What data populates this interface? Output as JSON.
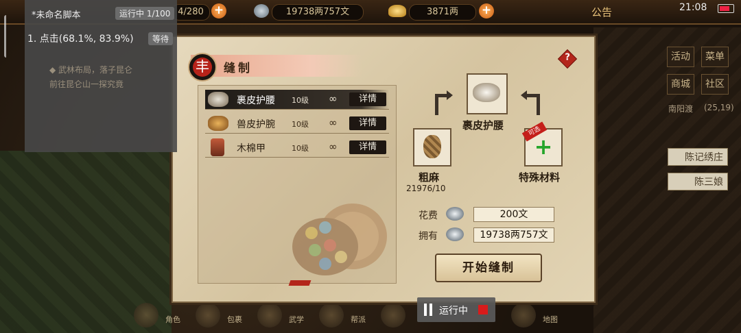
{
  "topbar": {
    "stamina": "4/280",
    "coins": "19738两757文",
    "gold": "3871两",
    "notice": "公告",
    "time": "21:08"
  },
  "script_panel": {
    "title": "*未命名脚本",
    "status": "运行中 1/100",
    "step": "1. 点击(68.1%, 83.9%)",
    "wait": "等待"
  },
  "quest": {
    "line1": "◆ 武林布局，落子昆仑",
    "line2": "前往昆仑山一探究竟"
  },
  "right_menu": {
    "activity": "活动",
    "menu": "菜单",
    "shop": "商城",
    "community": "社区",
    "location": "南阳渡",
    "coords": "(25,19)",
    "npc1": "陈记绣庄",
    "npc2": "陈三娘"
  },
  "bottom_bar": {
    "items": [
      "角色",
      "包裹",
      "武学",
      "帮派",
      "",
      "地图"
    ]
  },
  "running": {
    "label": "运行中"
  },
  "dialog": {
    "title": "缝制",
    "help": "?",
    "emblem": "丰",
    "recipes": [
      {
        "name": "裹皮护腰",
        "level": "10级",
        "qty": "∞",
        "detail": "详情"
      },
      {
        "name": "兽皮护腕",
        "level": "10级",
        "qty": "∞",
        "detail": "详情"
      },
      {
        "name": "木棉甲",
        "level": "10级",
        "qty": "∞",
        "detail": "详情"
      }
    ],
    "product_name": "裹皮护腰",
    "material_name": "粗麻",
    "material_count": "21976/10",
    "extra_tag": "可选",
    "extra_name": "特殊材料",
    "cost_label": "花费",
    "cost_value": "200文",
    "own_label": "拥有",
    "own_value": "19738两757文",
    "start_button": "开始缝制"
  }
}
